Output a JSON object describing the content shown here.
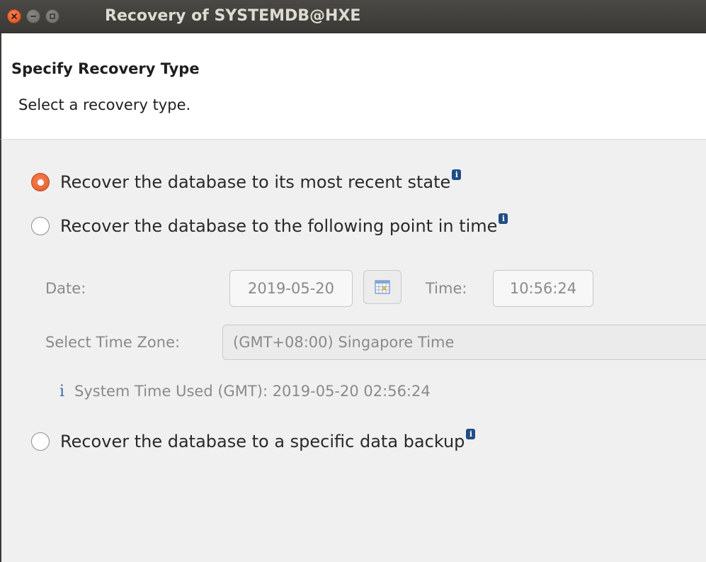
{
  "window": {
    "title": "Recovery of SYSTEMDB@HXE"
  },
  "header": {
    "title": "Specify Recovery Type",
    "subtitle": "Select a recovery type."
  },
  "options": [
    {
      "label": "Recover the database to its most recent state",
      "selected": true
    },
    {
      "label": "Recover the database to the following point in time",
      "selected": false
    },
    {
      "label": "Recover the database to a specific data backup",
      "selected": false
    }
  ],
  "point_in_time": {
    "date_label": "Date:",
    "date_value": "2019-05-20",
    "time_label": "Time:",
    "time_value": "10:56:24",
    "timezone_label": "Select Time Zone:",
    "timezone_value": "(GMT+08:00) Singapore Time",
    "system_time_note": "System Time Used (GMT): 2019-05-20 02:56:24"
  },
  "icons": {
    "info_badge": "i",
    "info_glyph": "i"
  },
  "colors": {
    "accent": "#e05a25",
    "titlebar": "#3c3b37",
    "disabled_text": "#8a8a8a",
    "info_blue": "#1f4d86"
  }
}
